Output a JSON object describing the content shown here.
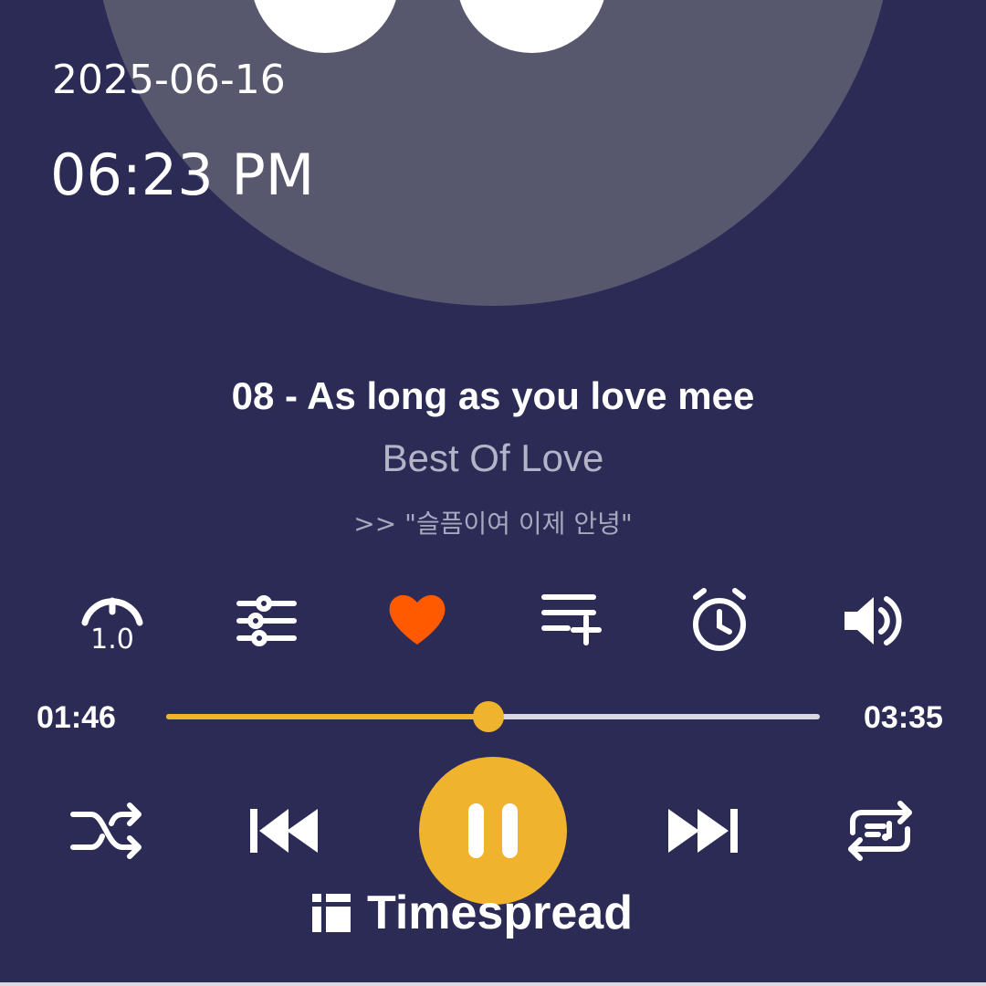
{
  "status": {
    "date": "2025-06-16",
    "time": "06:23 PM"
  },
  "track": {
    "title": "08 - As long as you love mee",
    "album": "Best Of Love",
    "lyric": ">> \"슬픔이여 이제 안녕\""
  },
  "options": {
    "speed_value": "1.0",
    "favorite_color": "#ff5a00"
  },
  "progress": {
    "elapsed": "01:46",
    "total": "03:35",
    "fraction": 0.493
  },
  "colors": {
    "background": "#2b2b56",
    "accent": "#efb32d"
  },
  "icons": [
    "speed-icon",
    "equalizer-icon",
    "heart-icon",
    "add-to-playlist-icon",
    "alarm-icon",
    "volume-icon",
    "shuffle-icon",
    "previous-icon",
    "pause-icon",
    "next-icon",
    "repeat-icon",
    "timespread-logo-icon"
  ],
  "watermark": {
    "text": "Timespread"
  }
}
